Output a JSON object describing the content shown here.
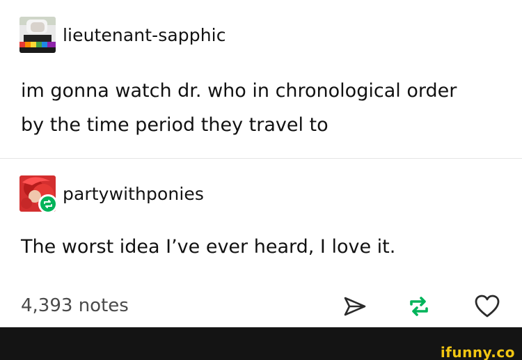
{
  "original_post": {
    "username": "lieutenant-sapphic",
    "text_line_1": "im gonna watch dr. who in chronological order",
    "text_line_2": "by the time period they travel to"
  },
  "reply_post": {
    "username": "partywithponies",
    "text": "The worst idea I’ve ever heard, I love it."
  },
  "footer": {
    "notes": "4,393 notes",
    "icons": [
      "share-icon",
      "reblog-icon",
      "heart-icon"
    ]
  },
  "watermark": "ifunny.co",
  "colors": {
    "reblog_green": "#00b45a",
    "text": "#111111",
    "notes_gray": "#4a4a4a",
    "watermark_yellow": "#f2c612"
  }
}
